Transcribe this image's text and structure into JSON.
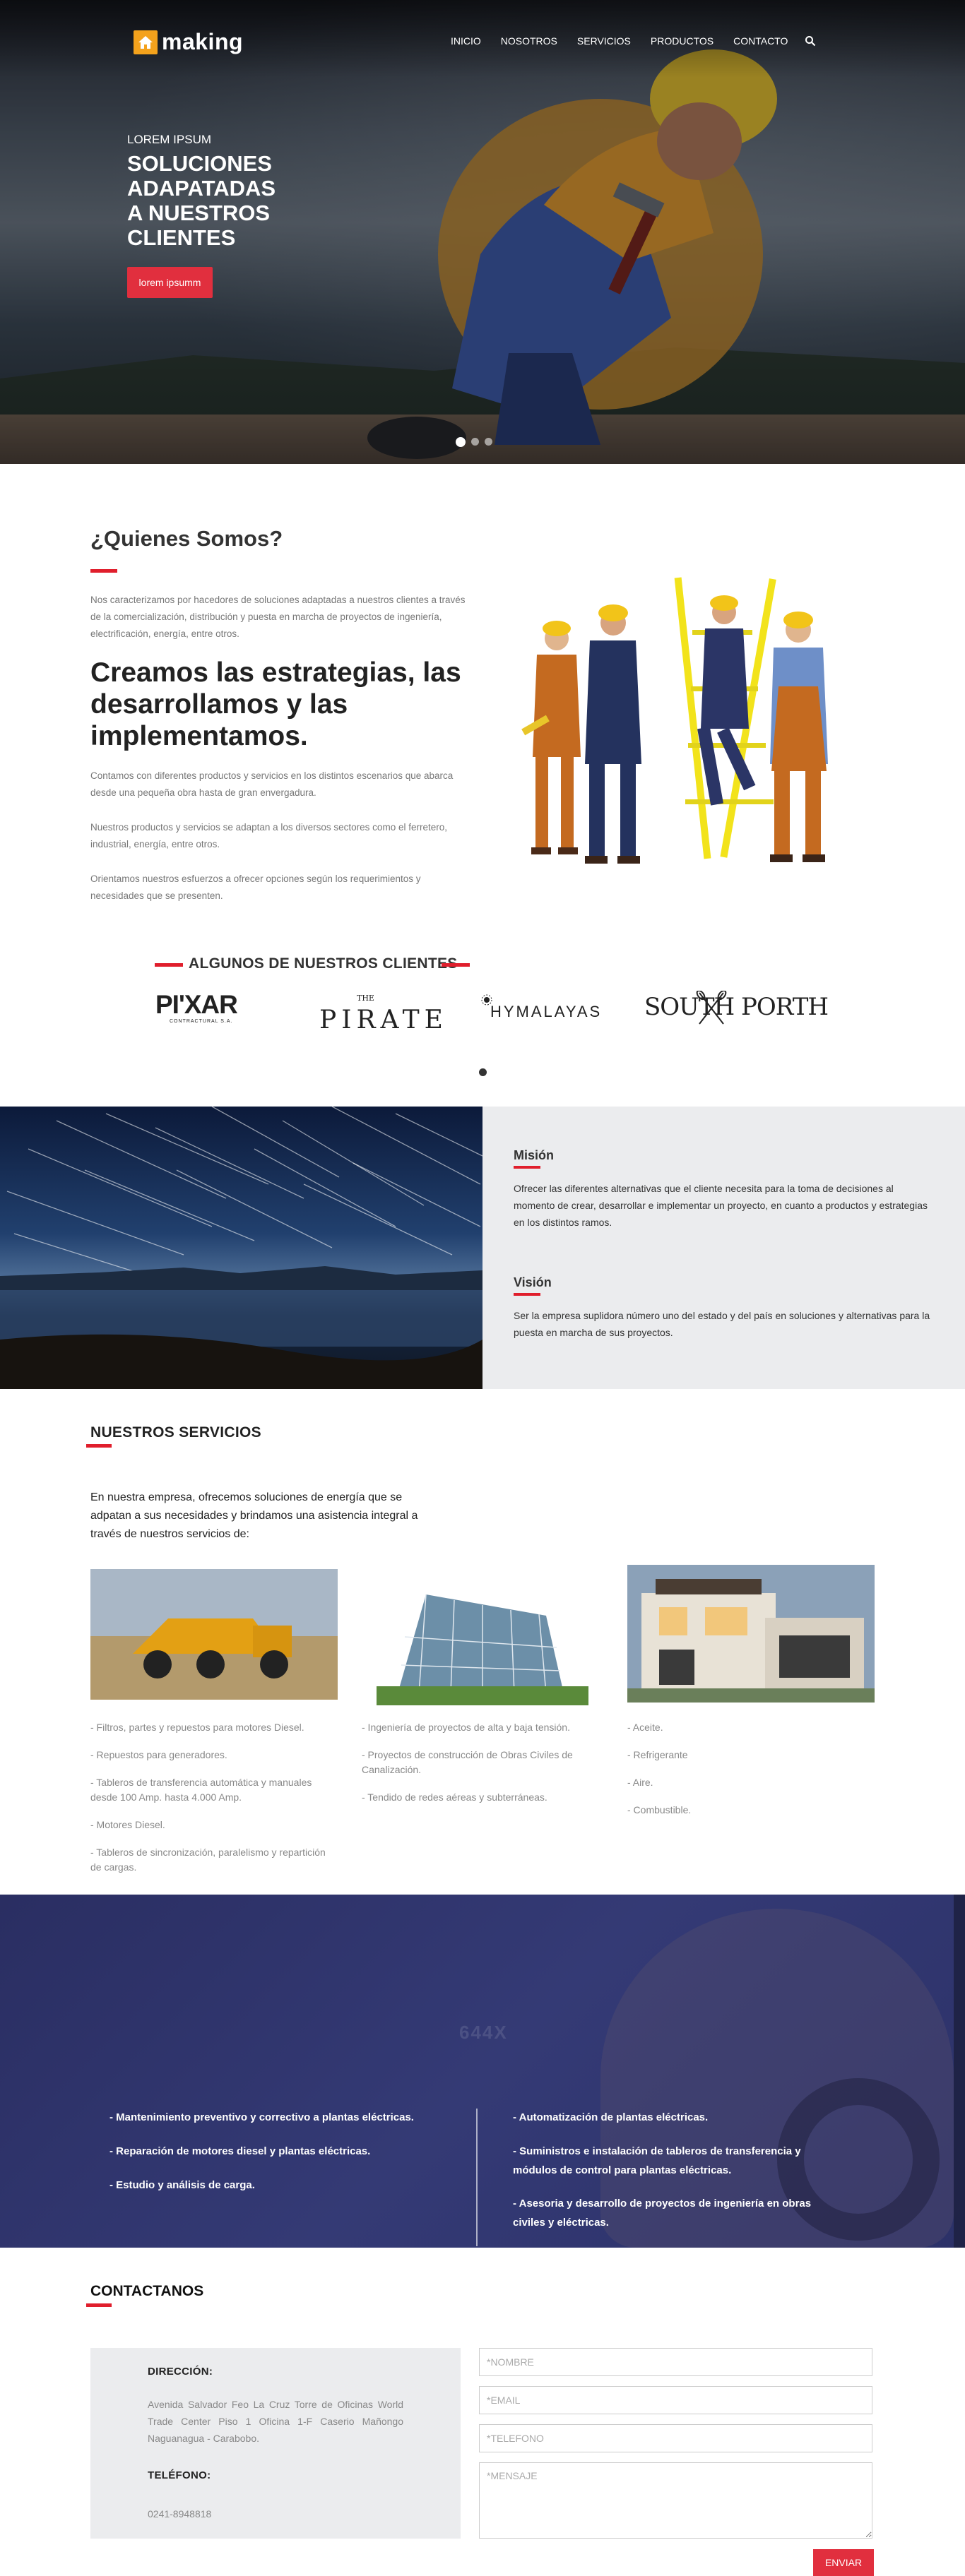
{
  "header": {
    "logo_text": "making",
    "nav": [
      "INICIO",
      "NOSOTROS",
      "SERVICIOS",
      "PRODUCTOS",
      "CONTACTO"
    ]
  },
  "hero": {
    "kicker": "LOREM IPSUM",
    "title": "SOLUCIONES\nADAPATADAS\nA NUESTROS\nCLIENTES",
    "button": "lorem ipsumm",
    "slides": 3,
    "active_slide": 1
  },
  "about": {
    "title": "¿Quienes Somos?",
    "p1": "Nos caracterizamos por hacedores de soluciones adaptadas a nuestros clientes a través de la comercialización, distribución y puesta en marcha de proyectos de ingeniería, electrificación, energía, entre otros.",
    "heading": "Creamos las estrategias, las desarrollamos y las implementamos.",
    "p2": "Contamos con diferentes productos y servicios en los distintos escenarios que abarca desde una pequeña obra hasta de gran envergadura.",
    "p3": "Nuestros productos y servicios se adaptan a los diversos sectores como el ferretero, industrial, energía, entre otros.",
    "p4": "Orientamos nuestros esfuerzos a ofrecer opciones según los requerimientos y necesidades que se presenten."
  },
  "clients": {
    "title": "ALGUNOS DE NUESTROS CLIENTES",
    "logos": {
      "pixar": "PI'XAR",
      "pixar_sub": "CONTRACTURAL S.A.",
      "pirate_small": "THE",
      "pirate": "PIRATE",
      "hymalayas": "HYMALAYAS",
      "southporth": "SOUTH PORTH"
    }
  },
  "mision_vision": {
    "mision_title": "Misión",
    "mision_text": "Ofrecer las diferentes alternativas que el cliente necesita para la toma de decisiones al momento de crear, desarrollar e implementar un proyecto, en cuanto a productos y estrategias en los distintos ramos.",
    "vision_title": "Visión",
    "vision_text": "Ser la empresa suplidora número uno del estado y del país en soluciones y alternativas para la puesta en marcha de sus proyectos."
  },
  "services": {
    "title": "NUESTROS SERVICIOS",
    "intro": "En nuestra empresa, ofrecemos soluciones de energía que se adpatan a sus necesidades y brindamos una asistencia integral a través de nuestros servicios de:",
    "col1": [
      "- Filtros, partes y repuestos para motores Diesel.",
      "- Repuestos para generadores.",
      "- Tableros de transferencia automática y manuales desde 100 Amp. hasta 4.000 Amp.",
      "- Motores Diesel.",
      "- Tableros de sincronización, paralelismo y repartición de cargas."
    ],
    "col2": [
      "- Ingeniería de proyectos de alta y baja tensión.",
      "- Proyectos de construcción de Obras Civiles de Canalización.",
      "- Tendido de redes aéreas y subterráneas."
    ],
    "col3": [
      "- Aceite.",
      "- Refrigerante",
      "- Aire.",
      "- Combustible."
    ]
  },
  "banner": {
    "ghost_text": "644X",
    "left": [
      "- Mantenimiento preventivo y correctivo a plantas eléctricas.",
      "- Reparación de motores diesel y plantas eléctricas.",
      "- Estudio y análisis de carga."
    ],
    "right": [
      "- Automatización de plantas eléctricas.",
      "- Suministros e instalación de tableros de transferencia y módulos de control para plantas eléctricas.",
      "- Asesoria y desarrollo de proyectos de ingeniería en obras civiles y eléctricas."
    ]
  },
  "contact": {
    "title": "CONTACTANOS",
    "address_label": "DIRECCIÓN:",
    "address": "Avenida Salvador Feo La Cruz Torre de Oficinas World Trade Center Piso 1 Oficina 1-F Caserio Mañongo Naguanagua - Carabobo.",
    "phone_label": "TELÉFONO:",
    "phone": "0241-8948818",
    "form": {
      "name_placeholder": "*NOMBRE",
      "email_placeholder": "*EMAIL",
      "phone_placeholder": "*TELEFONO",
      "message_placeholder": "*MENSAJE",
      "submit": "ENVIAR"
    }
  },
  "colors": {
    "accent": "#e01e2c",
    "logo": "#f4a21c",
    "banner": "#2f346c"
  }
}
